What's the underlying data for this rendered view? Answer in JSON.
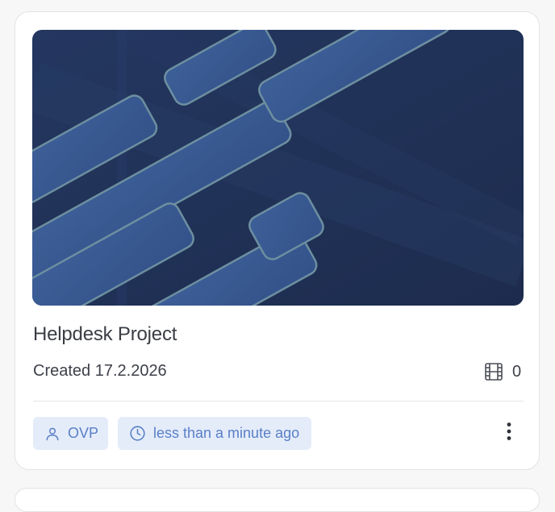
{
  "project_card": {
    "title": "Helpdesk Project",
    "created": "Created 17.2.2026",
    "video_count": "0",
    "owner": "OVP",
    "updated": "less than a minute ago",
    "thumbnail_colors": {
      "background": "#1f2e52",
      "shape": "#3a5a92",
      "edge": "#6d8fa0"
    },
    "icons": {
      "video_count": "film-icon",
      "owner": "user-icon",
      "updated": "clock-icon",
      "menu": "more-vertical-icon"
    }
  }
}
